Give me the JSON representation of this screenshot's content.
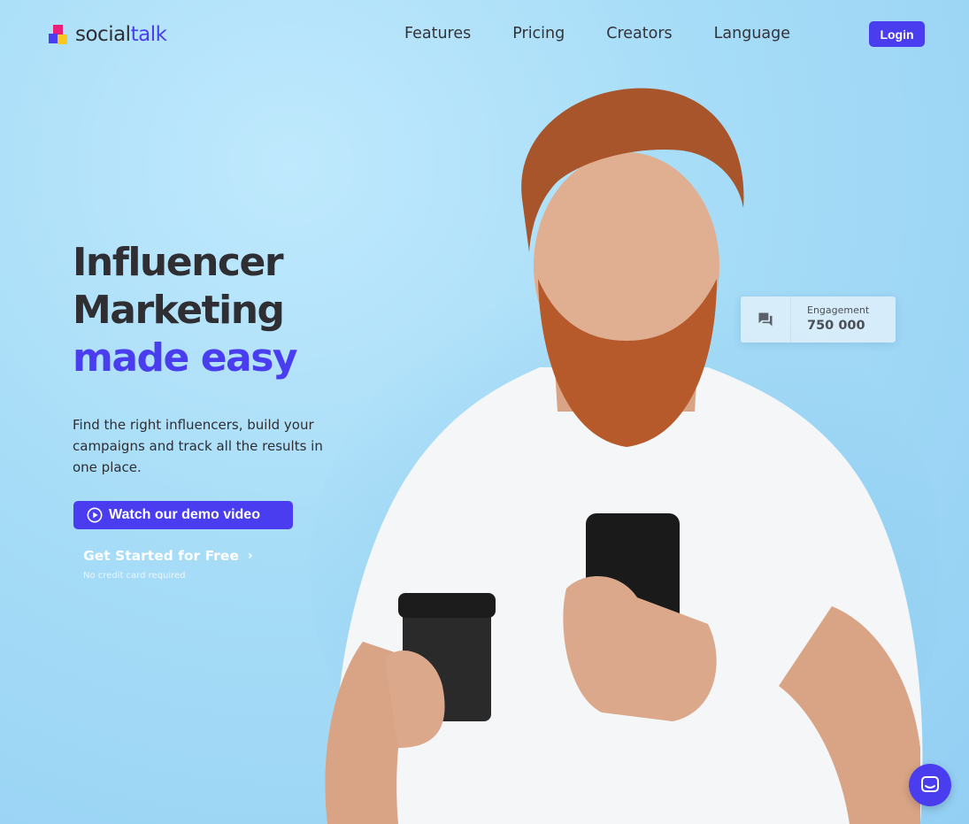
{
  "brand": {
    "name_part1": "social",
    "name_part2": "talk"
  },
  "nav": {
    "items": [
      "Features",
      "Pricing",
      "Creators",
      "Language"
    ],
    "login": "Login"
  },
  "hero": {
    "line1": "Influencer",
    "line2": "Marketing",
    "line3": "made easy",
    "subtitle": "Find the right influencers, build your campaigns and track all the results in one place.",
    "demo_button": "Watch our demo video",
    "get_started": "Get Started for Free",
    "no_card": "No credit card required"
  },
  "stat_card": {
    "label": "Engagement",
    "value": "750 000"
  },
  "colors": {
    "accent": "#4a3df0",
    "background": "#a6dcf7",
    "text": "#2e2e33"
  },
  "icons": [
    "logo-mark",
    "play-circle-icon",
    "chevron-right-icon",
    "chat-icon",
    "messenger-icon"
  ]
}
